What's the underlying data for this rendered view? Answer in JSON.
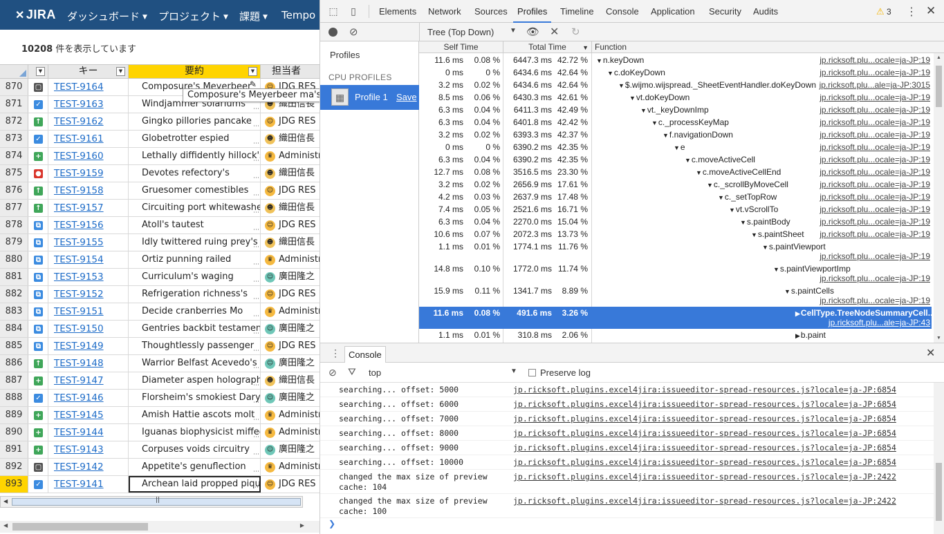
{
  "jira": {
    "logo_text": "JIRA",
    "nav": [
      {
        "label": "ダッシュボード"
      },
      {
        "label": "プロジェクト"
      },
      {
        "label": "課題"
      },
      {
        "label": "Tempo"
      }
    ],
    "count_number": "10208",
    "count_suffix": " 件を表示しています",
    "columns": {
      "key": "キー",
      "summary": "要約",
      "assignee": "担当者"
    },
    "tooltip": "Composure's Meyerbeer ma's Gu",
    "rows": [
      {
        "num": "870",
        "type": "task",
        "key": "TEST-9164",
        "summary": "Composure's Meyerbeer",
        "assignee": "JDG RES",
        "avatar": "jdg"
      },
      {
        "num": "871",
        "type": "check",
        "key": "TEST-9163",
        "summary": "Windjammer solariums",
        "assignee": "織田信長",
        "avatar": "oda"
      },
      {
        "num": "872",
        "type": "improve",
        "key": "TEST-9162",
        "summary": "Gingko pillories pancake",
        "assignee": "JDG RES",
        "avatar": "jdg"
      },
      {
        "num": "873",
        "type": "check",
        "key": "TEST-9161",
        "summary": "Globetrotter espied",
        "assignee": "織田信長",
        "avatar": "oda"
      },
      {
        "num": "874",
        "type": "newfeature",
        "key": "TEST-9160",
        "summary": "Lethally diffidently hillock's",
        "assignee": "Administr",
        "avatar": "admin"
      },
      {
        "num": "875",
        "type": "bug",
        "key": "TEST-9159",
        "summary": "Devotes refectory's",
        "assignee": "織田信長",
        "avatar": "oda"
      },
      {
        "num": "876",
        "type": "improve",
        "key": "TEST-9158",
        "summary": "Gruesomer comestibles",
        "assignee": "JDG RES",
        "avatar": "jdg"
      },
      {
        "num": "877",
        "type": "improve",
        "key": "TEST-9157",
        "summary": "Circuiting port whitewashed",
        "assignee": "織田信長",
        "avatar": "oda"
      },
      {
        "num": "878",
        "type": "subtask",
        "key": "TEST-9156",
        "summary": "Atoll's tautest",
        "assignee": "JDG RES",
        "avatar": "jdg"
      },
      {
        "num": "879",
        "type": "subtask",
        "key": "TEST-9155",
        "summary": "Idly twittered ruing prey's",
        "assignee": "織田信長",
        "avatar": "oda"
      },
      {
        "num": "880",
        "type": "subtask",
        "key": "TEST-9154",
        "summary": "Ortiz punning railed",
        "assignee": "Administr",
        "avatar": "admin"
      },
      {
        "num": "881",
        "type": "subtask",
        "key": "TEST-9153",
        "summary": "Curriculum's waging",
        "assignee": "廣田隆之",
        "avatar": "hirota"
      },
      {
        "num": "882",
        "type": "subtask",
        "key": "TEST-9152",
        "summary": "Refrigeration richness's",
        "assignee": "JDG RES",
        "avatar": "jdg"
      },
      {
        "num": "883",
        "type": "subtask",
        "key": "TEST-9151",
        "summary": "Decide cranberries Mo",
        "assignee": "Administr",
        "avatar": "admin"
      },
      {
        "num": "884",
        "type": "subtask",
        "key": "TEST-9150",
        "summary": "Gentries backbit testaments",
        "assignee": "廣田隆之",
        "avatar": "hirota"
      },
      {
        "num": "885",
        "type": "subtask",
        "key": "TEST-9149",
        "summary": "Thoughtlessly passenger",
        "assignee": "JDG RES",
        "avatar": "jdg"
      },
      {
        "num": "886",
        "type": "improve",
        "key": "TEST-9148",
        "summary": "Warrior Belfast Acevedo's",
        "assignee": "廣田隆之",
        "avatar": "hirota"
      },
      {
        "num": "887",
        "type": "newfeature",
        "key": "TEST-9147",
        "summary": "Diameter aspen holographic",
        "assignee": "織田信長",
        "avatar": "oda"
      },
      {
        "num": "888",
        "type": "check",
        "key": "TEST-9146",
        "summary": "Florsheim's smokiest Daryl",
        "assignee": "廣田隆之",
        "avatar": "hirota"
      },
      {
        "num": "889",
        "type": "newfeature",
        "key": "TEST-9145",
        "summary": "Amish Hattie ascots molt",
        "assignee": "Administr",
        "avatar": "admin"
      },
      {
        "num": "890",
        "type": "newfeature",
        "key": "TEST-9144",
        "summary": "Iguanas biophysicist miffed",
        "assignee": "Administr",
        "avatar": "admin"
      },
      {
        "num": "891",
        "type": "newfeature",
        "key": "TEST-9143",
        "summary": "Corpuses voids circuitry",
        "assignee": "廣田隆之",
        "avatar": "hirota"
      },
      {
        "num": "892",
        "type": "task",
        "key": "TEST-9142",
        "summary": "Appetite's genuflection",
        "assignee": "Administr",
        "avatar": "admin"
      },
      {
        "num": "893",
        "type": "check",
        "key": "TEST-9141",
        "summary": "Archean laid propped pique",
        "assignee": "JDG RES",
        "avatar": "jdg",
        "active": true
      }
    ]
  },
  "devtools": {
    "tabs": [
      "Elements",
      "Network",
      "Sources",
      "Profiles",
      "Timeline",
      "Console",
      "Application",
      "Security",
      "Audits"
    ],
    "active_tab": "Profiles",
    "warning_count": "3",
    "view_mode": "Tree (Top Down)",
    "sidebar": {
      "title": "Profiles",
      "section": "CPU PROFILES",
      "profile_label": "Profile 1",
      "save_label": "Save"
    },
    "columns": {
      "self": "Self Time",
      "total": "Total Time",
      "function": "Function"
    },
    "profile_rows": [
      {
        "self_ms": "11.6 ms",
        "self_pct": "0.08 %",
        "total_ms": "6447.3 ms",
        "total_pct": "42.72 %",
        "depth": 0,
        "twisty": "open",
        "fn": "n.keyDown",
        "url": "jp.ricksoft.plu...ocale=ja-JP:19"
      },
      {
        "self_ms": "0 ms",
        "self_pct": "0 %",
        "total_ms": "6434.6 ms",
        "total_pct": "42.64 %",
        "depth": 1,
        "twisty": "open",
        "fn": "c.doKeyDown",
        "url": "jp.ricksoft.plu...ocale=ja-JP:19"
      },
      {
        "self_ms": "3.2 ms",
        "self_pct": "0.02 %",
        "total_ms": "6434.6 ms",
        "total_pct": "42.64 %",
        "depth": 2,
        "twisty": "open",
        "fn": "$.wijmo.wijspread._SheetEventHandler.doKeyDown",
        "url": "jp.ricksoft.plu...ale=ja-JP:3015"
      },
      {
        "self_ms": "8.5 ms",
        "self_pct": "0.06 %",
        "total_ms": "6430.3 ms",
        "total_pct": "42.61 %",
        "depth": 3,
        "twisty": "open",
        "fn": "vt.doKeyDown",
        "url": "jp.ricksoft.plu...ocale=ja-JP:19"
      },
      {
        "self_ms": "6.3 ms",
        "self_pct": "0.04 %",
        "total_ms": "6411.3 ms",
        "total_pct": "42.49 %",
        "depth": 4,
        "twisty": "open",
        "fn": "vt._keyDownImp",
        "url": "jp.ricksoft.plu...ocale=ja-JP:19"
      },
      {
        "self_ms": "6.3 ms",
        "self_pct": "0.04 %",
        "total_ms": "6401.8 ms",
        "total_pct": "42.42 %",
        "depth": 5,
        "twisty": "open",
        "fn": "c._processKeyMap",
        "url": "jp.ricksoft.plu...ocale=ja-JP:19"
      },
      {
        "self_ms": "3.2 ms",
        "self_pct": "0.02 %",
        "total_ms": "6393.3 ms",
        "total_pct": "42.37 %",
        "depth": 6,
        "twisty": "open",
        "fn": "f.navigationDown",
        "url": "jp.ricksoft.plu...ocale=ja-JP:19"
      },
      {
        "self_ms": "0 ms",
        "self_pct": "0 %",
        "total_ms": "6390.2 ms",
        "total_pct": "42.35 %",
        "depth": 7,
        "twisty": "open",
        "fn": "e",
        "url": "jp.ricksoft.plu...ocale=ja-JP:19"
      },
      {
        "self_ms": "6.3 ms",
        "self_pct": "0.04 %",
        "total_ms": "6390.2 ms",
        "total_pct": "42.35 %",
        "depth": 8,
        "twisty": "open",
        "fn": "c.moveActiveCell",
        "url": "jp.ricksoft.plu...ocale=ja-JP:19"
      },
      {
        "self_ms": "12.7 ms",
        "self_pct": "0.08 %",
        "total_ms": "3516.5 ms",
        "total_pct": "23.30 %",
        "depth": 9,
        "twisty": "open",
        "fn": "c.moveActiveCellEnd",
        "url": "jp.ricksoft.plu...ocale=ja-JP:19"
      },
      {
        "self_ms": "3.2 ms",
        "self_pct": "0.02 %",
        "total_ms": "2656.9 ms",
        "total_pct": "17.61 %",
        "depth": 10,
        "twisty": "open",
        "fn": "c._scrollByMoveCell",
        "url": "jp.ricksoft.plu...ocale=ja-JP:19"
      },
      {
        "self_ms": "4.2 ms",
        "self_pct": "0.03 %",
        "total_ms": "2637.9 ms",
        "total_pct": "17.48 %",
        "depth": 11,
        "twisty": "open",
        "fn": "c._setTopRow",
        "url": "jp.ricksoft.plu...ocale=ja-JP:19"
      },
      {
        "self_ms": "7.4 ms",
        "self_pct": "0.05 %",
        "total_ms": "2521.6 ms",
        "total_pct": "16.71 %",
        "depth": 12,
        "twisty": "open",
        "fn": "vt.vScrollTo",
        "url": "jp.ricksoft.plu...ocale=ja-JP:19"
      },
      {
        "self_ms": "6.3 ms",
        "self_pct": "0.04 %",
        "total_ms": "2270.0 ms",
        "total_pct": "15.04 %",
        "depth": 13,
        "twisty": "open",
        "fn": "s.paintBody",
        "url": "jp.ricksoft.plu...ocale=ja-JP:19"
      },
      {
        "self_ms": "10.6 ms",
        "self_pct": "0.07 %",
        "total_ms": "2072.3 ms",
        "total_pct": "13.73 %",
        "depth": 14,
        "twisty": "open",
        "fn": "s.paintSheet",
        "url": "jp.ricksoft.plu...ocale=ja-JP:19"
      },
      {
        "self_ms": "1.1 ms",
        "self_pct": "0.01 %",
        "total_ms": "1774.1 ms",
        "total_pct": "11.76 %",
        "depth": 15,
        "twisty": "open",
        "fn": "s.paintViewport",
        "url": "jp.ricksoft.plu...ocale=ja-JP:19",
        "tall": true
      },
      {
        "self_ms": "14.8 ms",
        "self_pct": "0.10 %",
        "total_ms": "1772.0 ms",
        "total_pct": "11.74 %",
        "depth": 16,
        "twisty": "open",
        "fn": "s.paintViewportImp",
        "url": "jp.ricksoft.plu...ocale=ja-JP:19",
        "tall": true
      },
      {
        "self_ms": "15.9 ms",
        "self_pct": "0.11 %",
        "total_ms": "1341.7 ms",
        "total_pct": "8.89 %",
        "depth": 17,
        "twisty": "open",
        "fn": "s.paintCells",
        "url": "jp.ricksoft.plu...ocale=ja-JP:19",
        "tall": true
      },
      {
        "self_ms": "11.6 ms",
        "self_pct": "0.08 %",
        "total_ms": "491.6 ms",
        "total_pct": "3.26 %",
        "depth": 18,
        "twisty": "closed",
        "fn": "CellType.TreeNodeSummaryCell...",
        "url": "jp.ricksoft.plu...ale=ja-JP:43",
        "tall": true,
        "selected": true
      },
      {
        "self_ms": "1.1 ms",
        "self_pct": "0.01 %",
        "total_ms": "310.8 ms",
        "total_pct": "2.06 %",
        "depth": 18,
        "twisty": "closed",
        "fn": "b.paint",
        "url": "",
        "tall": false
      }
    ],
    "drawer_tab": "Console",
    "console": {
      "context": "top",
      "preserve_log_label": "Preserve log",
      "messages": [
        {
          "text": "searching... offset: 5000",
          "source": "jp.ricksoft.plugins.excel4jira:issueeditor-spread-resources.js?locale=ja-JP:6854"
        },
        {
          "text": "searching... offset: 6000",
          "source": "jp.ricksoft.plugins.excel4jira:issueeditor-spread-resources.js?locale=ja-JP:6854"
        },
        {
          "text": "searching... offset: 7000",
          "source": "jp.ricksoft.plugins.excel4jira:issueeditor-spread-resources.js?locale=ja-JP:6854"
        },
        {
          "text": "searching... offset: 8000",
          "source": "jp.ricksoft.plugins.excel4jira:issueeditor-spread-resources.js?locale=ja-JP:6854"
        },
        {
          "text": "searching... offset: 9000",
          "source": "jp.ricksoft.plugins.excel4jira:issueeditor-spread-resources.js?locale=ja-JP:6854"
        },
        {
          "text": "searching... offset: 10000",
          "source": "jp.ricksoft.plugins.excel4jira:issueeditor-spread-resources.js?locale=ja-JP:6854"
        },
        {
          "text": "changed the max size of preview\ncache: 104",
          "source": "jp.ricksoft.plugins.excel4jira:issueeditor-spread-resources.js?locale=ja-JP:2422"
        },
        {
          "text": "changed the max size of preview\ncache: 100",
          "source": "jp.ricksoft.plugins.excel4jira:issueeditor-spread-resources.js?locale=ja-JP:2422"
        }
      ]
    }
  },
  "colors": {
    "jira_header": "#205081",
    "selection_blue": "#3879d9",
    "active_yellow": "#ffd400",
    "link_blue": "#1e6cc8"
  },
  "icons": {
    "task": "square-dot-icon",
    "check": "checkmark-icon",
    "improve": "up-arrow-icon",
    "newfeature": "plus-icon",
    "bug": "bug-dot-icon",
    "subtask": "subtask-icon"
  }
}
